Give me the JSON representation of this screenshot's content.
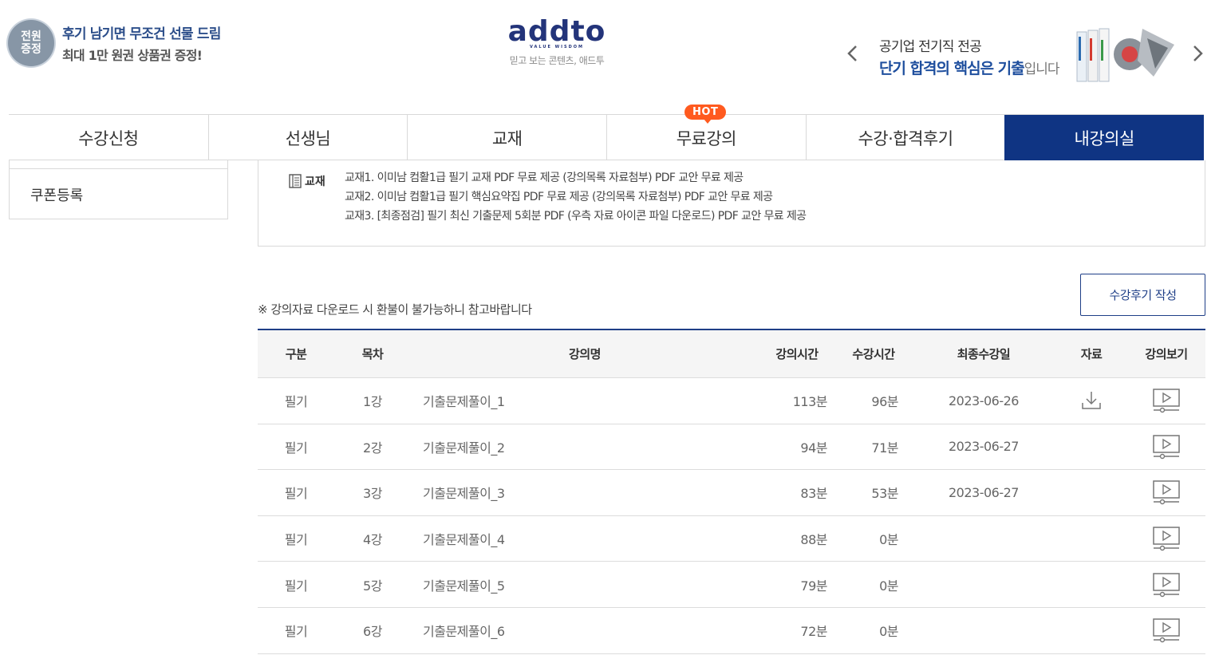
{
  "promo": {
    "badge_line1": "전원",
    "badge_line2": "증정",
    "line1": "후기 남기면 무조건 선물 드림",
    "line2": "최대 1만 원권 상품권 증정!"
  },
  "logo": {
    "word": "addto",
    "sub": "VALUE WISDOM",
    "tagline": "믿고 보는 콘텐츠, 애드투"
  },
  "banner": {
    "line1": "공기업 전기직 전공",
    "line2_bold": "단기 합격의 핵심은 기출",
    "line2_light": "입니다"
  },
  "nav": {
    "items": [
      {
        "label": "수강신청"
      },
      {
        "label": "선생님"
      },
      {
        "label": "교재"
      },
      {
        "label": "무료강의",
        "badge": "HOT"
      },
      {
        "label": "수강·합격후기"
      },
      {
        "label": "내강의실"
      }
    ]
  },
  "sidebar": {
    "item": "쿠폰등록"
  },
  "textbook": {
    "label": "교재",
    "lines": [
      "교재1. 이미남 컴활1급 필기 교재 PDF 무료 제공 (강의목록 자료첨부) PDF 교안 무료 제공",
      "교재2. 이미남 컴활1급 필기 핵심요약집 PDF 무료 제공 (강의목록 자료첨부) PDF 교안 무료 제공",
      "교재3. [최종점검] 필기 최신 기출문제 5회분 PDF (우측 자료 아이콘 파일 다운로드) PDF 교안 무료 제공"
    ]
  },
  "notice": "※ 강의자료 다운로드 시 환불이 불가능하니 참고바랍니다",
  "review_button": "수강후기 작성",
  "table": {
    "headers": {
      "type": "구분",
      "index": "목차",
      "title": "강의명",
      "duration": "강의시간",
      "watched": "수강시간",
      "last": "최종수강일",
      "data": "자료",
      "view": "강의보기"
    },
    "rows": [
      {
        "type": "필기",
        "index": "1강",
        "title": "기출문제풀이_1",
        "duration": "113분",
        "watched": "96분",
        "last": "2023-06-26",
        "has_download": true
      },
      {
        "type": "필기",
        "index": "2강",
        "title": "기출문제풀이_2",
        "duration": "94분",
        "watched": "71분",
        "last": "2023-06-27",
        "has_download": false
      },
      {
        "type": "필기",
        "index": "3강",
        "title": "기출문제풀이_3",
        "duration": "83분",
        "watched": "53분",
        "last": "2023-06-27",
        "has_download": false
      },
      {
        "type": "필기",
        "index": "4강",
        "title": "기출문제풀이_4",
        "duration": "88분",
        "watched": "0분",
        "last": "",
        "has_download": false
      },
      {
        "type": "필기",
        "index": "5강",
        "title": "기출문제풀이_5",
        "duration": "79분",
        "watched": "0분",
        "last": "",
        "has_download": false
      },
      {
        "type": "필기",
        "index": "6강",
        "title": "기출문제풀이_6",
        "duration": "72분",
        "watched": "0분",
        "last": "",
        "has_download": false
      }
    ]
  },
  "icons": {
    "download": "download-icon",
    "play": "play-video-icon",
    "textbook": "book-icon"
  },
  "colors": {
    "primary_navy": "#0f3483",
    "hot_orange": "#ff5a1f",
    "banner_blue": "#1f4f9e"
  }
}
